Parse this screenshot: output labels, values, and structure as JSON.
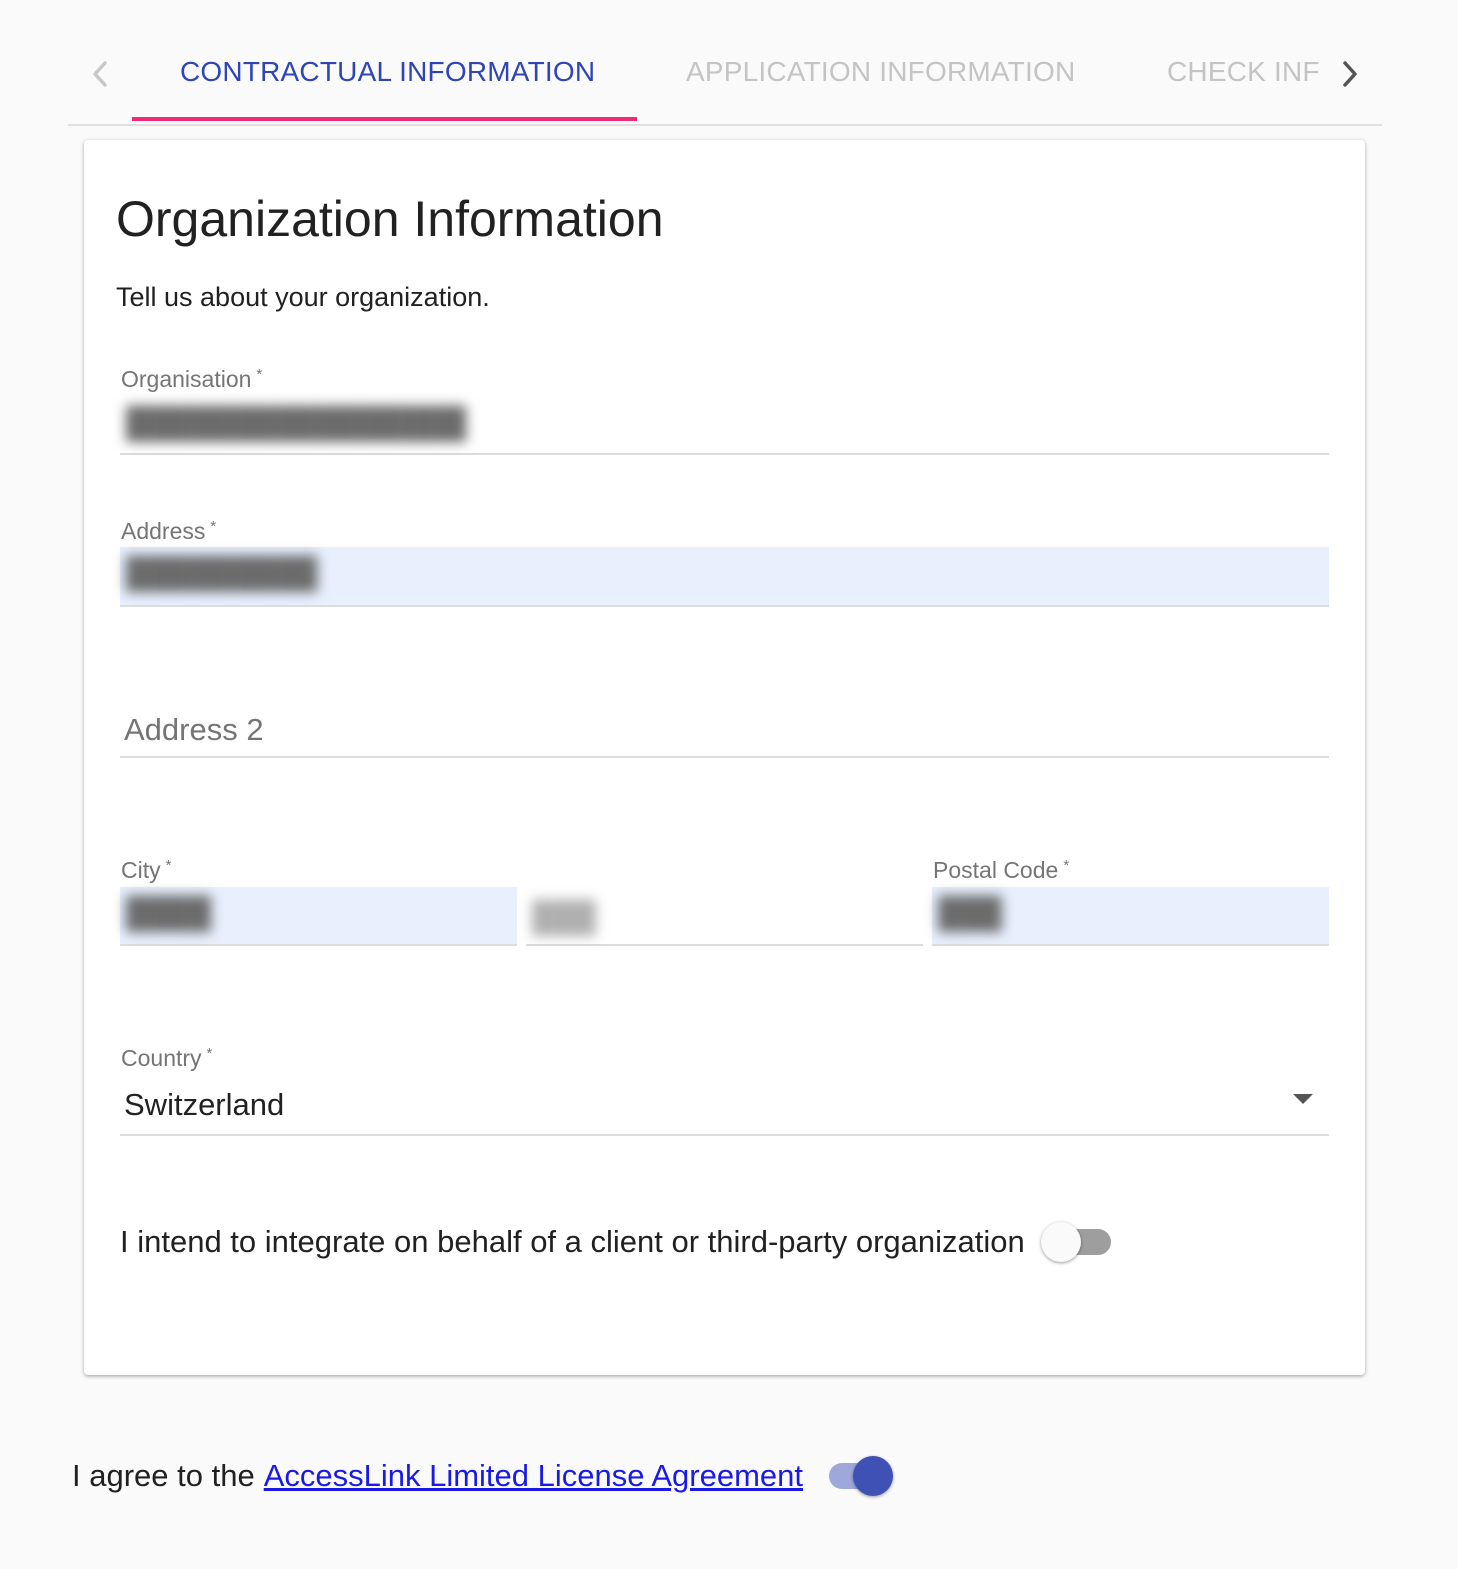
{
  "tabs": {
    "items": [
      {
        "label": "CONTRACTUAL INFORMATION",
        "active": true
      },
      {
        "label": "APPLICATION INFORMATION",
        "active": false
      },
      {
        "label": "CHECK INF",
        "active": false
      }
    ],
    "prev_icon": "chevron-left-icon",
    "next_icon": "chevron-right-icon"
  },
  "card": {
    "title": "Organization Information",
    "subtitle": "Tell us about your organization."
  },
  "form": {
    "organisation": {
      "label": "Organisation",
      "required_mark": "*"
    },
    "address": {
      "label": "Address",
      "required_mark": "*"
    },
    "address2": {
      "placeholder": "Address 2"
    },
    "city": {
      "label": "City",
      "required_mark": "*"
    },
    "postal_code": {
      "label": "Postal Code",
      "required_mark": "*"
    },
    "country": {
      "label": "Country",
      "required_mark": "*",
      "value": "Switzerland"
    }
  },
  "third_party": {
    "label": "I intend to integrate on behalf of a client or third-party organization",
    "checked": false
  },
  "agreement": {
    "prefix": "I agree to the",
    "link_text": "AccessLink Limited License Agreement",
    "checked": true
  },
  "colors": {
    "accent": "#3f51b5",
    "tab_ink": "#ef2b73",
    "autofill": "#e8f0fe",
    "link": "#1a1ae6"
  }
}
